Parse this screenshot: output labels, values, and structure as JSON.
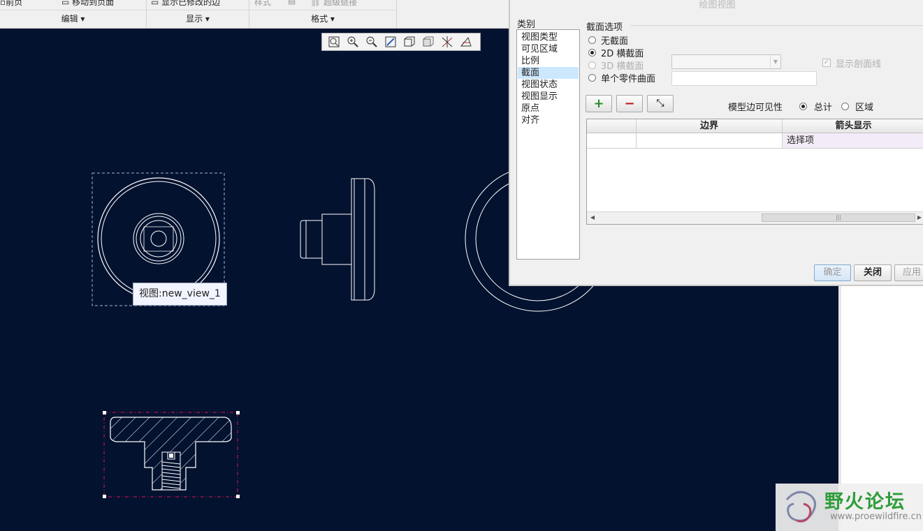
{
  "ribbon": {
    "top_buttons": [
      {
        "label": "前页",
        "disabled": false
      },
      {
        "label": "移动到页面",
        "disabled": false
      },
      {
        "label": "显示已修改的边",
        "disabled": false
      },
      {
        "label": "样式",
        "disabled": true
      },
      {
        "label": "超级链接",
        "disabled": true
      }
    ],
    "groups": [
      {
        "label": "编辑 ▾"
      },
      {
        "label": "显示 ▾"
      },
      {
        "label": "格式 ▾"
      }
    ]
  },
  "view_toolbar": {
    "icons": [
      "refit-icon",
      "zoom-in-icon",
      "zoom-out-icon",
      "repaint-icon",
      "view-orientation-icon",
      "display-style-icon",
      "datum-display-icon",
      "annotation-display-icon"
    ]
  },
  "tooltip": {
    "text": "视图:new_view_1"
  },
  "dialog": {
    "title": "绘图视图",
    "category_label": "类别",
    "categories": [
      {
        "label": "视图类型",
        "selected": false
      },
      {
        "label": "可见区域",
        "selected": false
      },
      {
        "label": "比例",
        "selected": false
      },
      {
        "label": "截面",
        "selected": true
      },
      {
        "label": "视图状态",
        "selected": false
      },
      {
        "label": "视图显示",
        "selected": false
      },
      {
        "label": "原点",
        "selected": false
      },
      {
        "label": "对齐",
        "selected": false
      }
    ],
    "section_options_label": "截面选项",
    "section_options": [
      {
        "label": "无截面",
        "checked": false,
        "disabled": false
      },
      {
        "label": "2D  横截面",
        "checked": true,
        "disabled": false
      },
      {
        "label": "3D  横截面",
        "checked": false,
        "disabled": true
      },
      {
        "label": "单个零件曲面",
        "checked": false,
        "disabled": false
      }
    ],
    "show_hatch_label": "显示剖面线",
    "show_hatch_checked": true,
    "edge_visibility_label": "模型边可见性",
    "edge_visibility_options": [
      {
        "label": "总计",
        "checked": true
      },
      {
        "label": "区域",
        "checked": false
      }
    ],
    "table": {
      "columns": [
        "",
        "边界",
        "箭头显示"
      ],
      "rows": [
        [
          "",
          "",
          "选择项"
        ]
      ]
    },
    "buttons": {
      "ok": "确定",
      "close": "关闭",
      "apply": "应用"
    }
  },
  "watermark": {
    "brand": "野火论坛",
    "url": "www.proewildfire.cn"
  },
  "colors": {
    "canvas": "#03122f",
    "geometry": "#ffffff",
    "selection": "#d4145a",
    "accent_green": "#2a8a2a",
    "accent_red": "#c0161c"
  }
}
